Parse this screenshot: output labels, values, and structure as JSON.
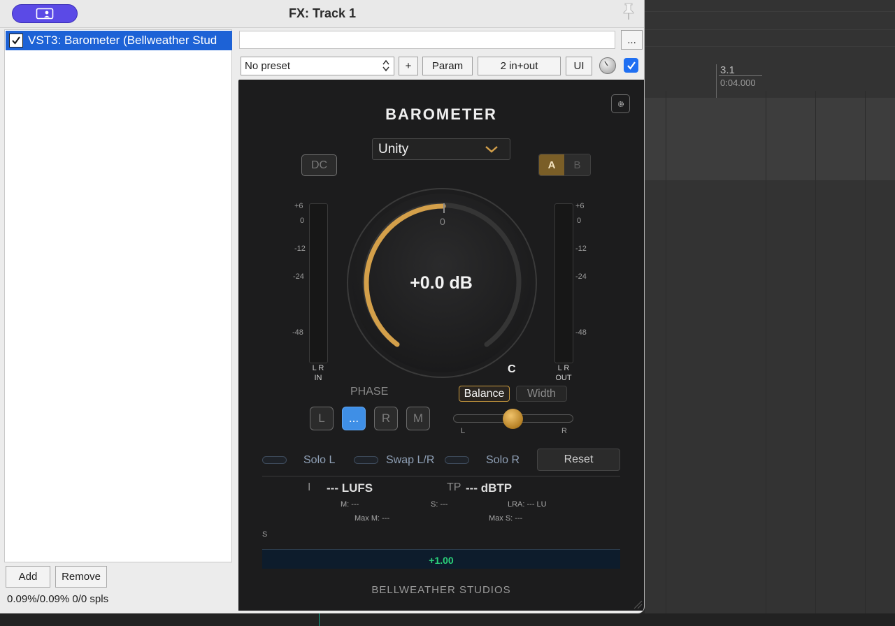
{
  "window": {
    "title": "FX: Track 1"
  },
  "fx_list": {
    "items": [
      {
        "label": "VST3: Barometer (Bellweather Stud",
        "enabled": true
      }
    ]
  },
  "bottom": {
    "add_label": "Add",
    "remove_label": "Remove",
    "cpu_text": "0.09%/0.09% 0/0 spls"
  },
  "toolbar": {
    "param_filter_value": "",
    "more_label": "...",
    "preset_value": "No preset",
    "plus_label": "+",
    "param_label": "Param",
    "io_label": "2 in+out",
    "ui_label": "UI",
    "bypass_checked": true
  },
  "timeline": {
    "marker": "3.1",
    "time": "0:04.000"
  },
  "plugin": {
    "title": "BAROMETER",
    "preset": "Unity",
    "dc_label": "DC",
    "a_label": "A",
    "b_label": "B",
    "meter_scale": [
      "+6",
      "0",
      "-12",
      "-24",
      "-48"
    ],
    "meter_in": {
      "lr": "L  R",
      "label": "IN"
    },
    "meter_out": {
      "lr": "L  R",
      "label": "OUT"
    },
    "knob": {
      "zero_label": "0",
      "value_text": "+0.0 dB",
      "pan_label": "C"
    },
    "phase": {
      "label": "PHASE",
      "buttons": [
        "L",
        "...",
        "R",
        "M"
      ],
      "active_index": 1
    },
    "balance_label": "Balance",
    "width_label": "Width",
    "slider": {
      "left": "L",
      "right": "R",
      "position": 0.5
    },
    "toggles": {
      "solo_l": "Solo L",
      "swap": "Swap L/R",
      "solo_r": "Solo R"
    },
    "reset_label": "Reset",
    "loudness": {
      "i_label": "I",
      "lufs": "--- LUFS",
      "tp_label": "TP",
      "dbtp": "--- dBTP",
      "m": "M: ---",
      "s": "S: ---",
      "lra": "LRA: --- LU",
      "max_m": "Max M: ---",
      "max_s": "Max S: ---"
    },
    "graph_label": "S",
    "graph_value": "+1.00",
    "footer": "BELLWEATHER STUDIOS"
  },
  "colors": {
    "accent_gold": "#d4a04a",
    "blue": "#1d62d6",
    "purple": "#5b4ae6",
    "green": "#2ad07a"
  }
}
